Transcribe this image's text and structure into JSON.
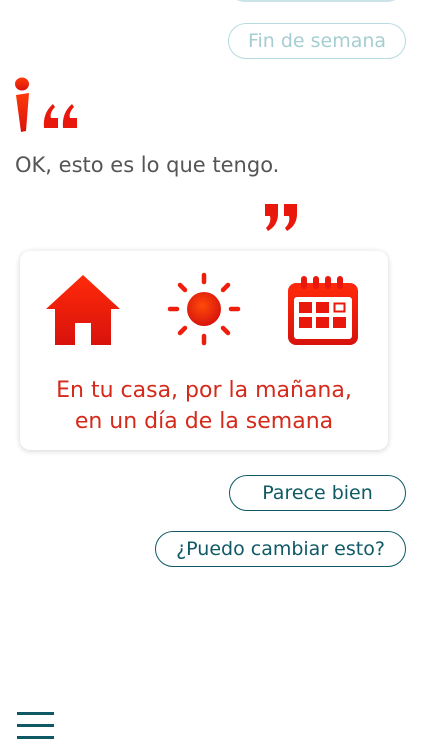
{
  "options": {
    "weekend_label": "Fin de semana",
    "looks_good_label": "Parece bien",
    "change_label": "¿Puedo cambiar esto?"
  },
  "assistant": {
    "message": "OK, esto es lo que tengo."
  },
  "summary_card": {
    "line1": "En tu casa, por la mañana,",
    "line2": "en un día de la semana",
    "icons": [
      "house-icon",
      "sun-icon",
      "calendar-icon"
    ]
  },
  "colors": {
    "accent_red": "#e8180c",
    "text_red": "#d42a1c",
    "teal": "#0f5966",
    "faded_teal": "#b7dbe0",
    "message_gray": "#555555"
  }
}
